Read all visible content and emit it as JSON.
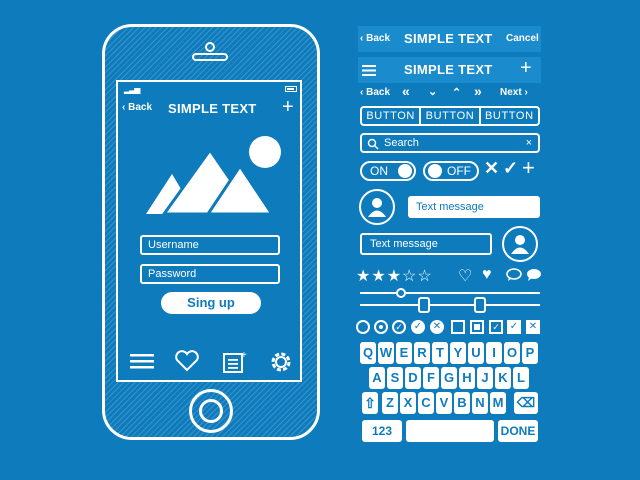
{
  "phone": {
    "back_label": "Back",
    "title": "SIMPLE TEXT",
    "username_placeholder": "Username",
    "password_placeholder": "Password",
    "signup_label": "Sing up"
  },
  "panel": {
    "bar1": {
      "back": "Back",
      "title": "SIMPLE TEXT",
      "cancel": "Cancel"
    },
    "bar2": {
      "title": "SIMPLE TEXT"
    },
    "bar3": {
      "back": "Back",
      "next": "Next"
    },
    "segment": [
      "BUTTON",
      "BUTTON",
      "BUTTON"
    ],
    "search_placeholder": "Search",
    "toggle_on": "ON",
    "toggle_off": "OFF",
    "message_received": "Text message",
    "message_sent": "Text message",
    "keyboard": {
      "row1": [
        "Q",
        "W",
        "E",
        "R",
        "T",
        "Y",
        "U",
        "I",
        "O",
        "P"
      ],
      "row2": [
        "A",
        "S",
        "D",
        "F",
        "G",
        "H",
        "J",
        "K",
        "L"
      ],
      "row3": [
        "Z",
        "X",
        "C",
        "V",
        "B",
        "N",
        "M"
      ],
      "numbers": "123",
      "done": "DONE"
    }
  },
  "colors": {
    "background": "#0e7bbd",
    "bar": "#1a8bcc",
    "foreground": "#ffffff"
  }
}
